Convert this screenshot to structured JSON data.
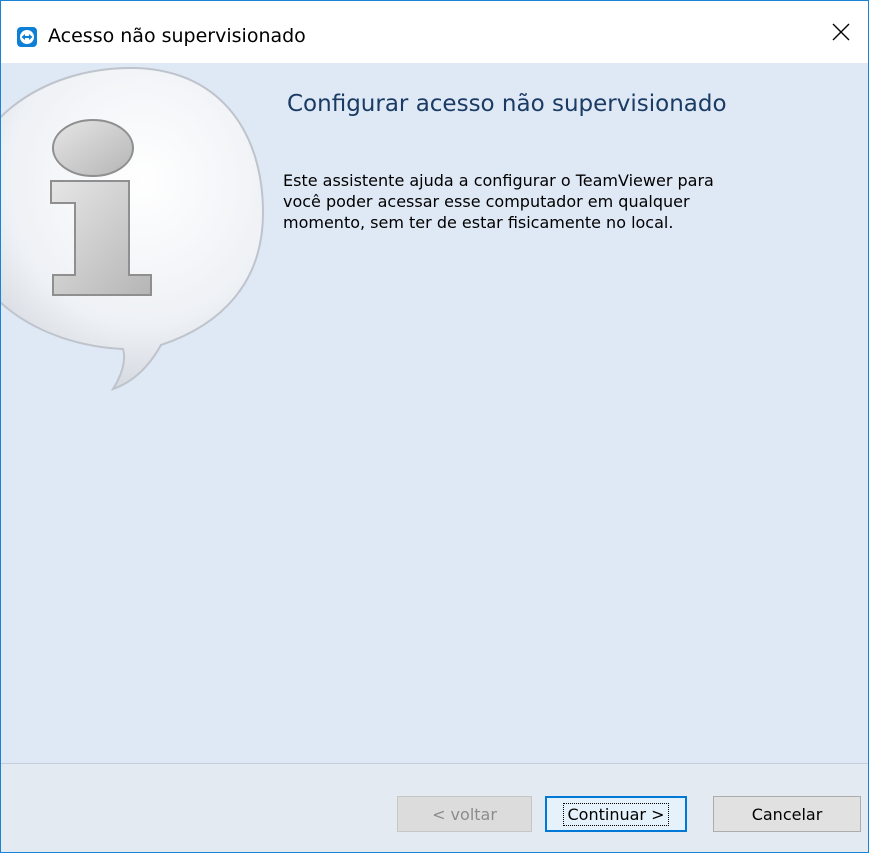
{
  "window": {
    "title": "Acesso não supervisionado",
    "app_icon": "teamviewer-icon",
    "close_icon": "close-icon"
  },
  "content": {
    "heading": "Configurar acesso não supervisionado",
    "description_lines": [
      "Este assistente ajuda a configurar o TeamViewer para",
      "você poder acessar esse computador em qualquer",
      "momento, sem ter de estar fisicamente no local."
    ],
    "graphic_icon": "info-speech-bubble-icon"
  },
  "buttons": {
    "back": "< voltar",
    "continue": "Continuar >",
    "cancel": "Cancelar"
  },
  "colors": {
    "accent": "#0078d7",
    "client_background": "#dfe8f5",
    "heading": "#1a3b63"
  }
}
